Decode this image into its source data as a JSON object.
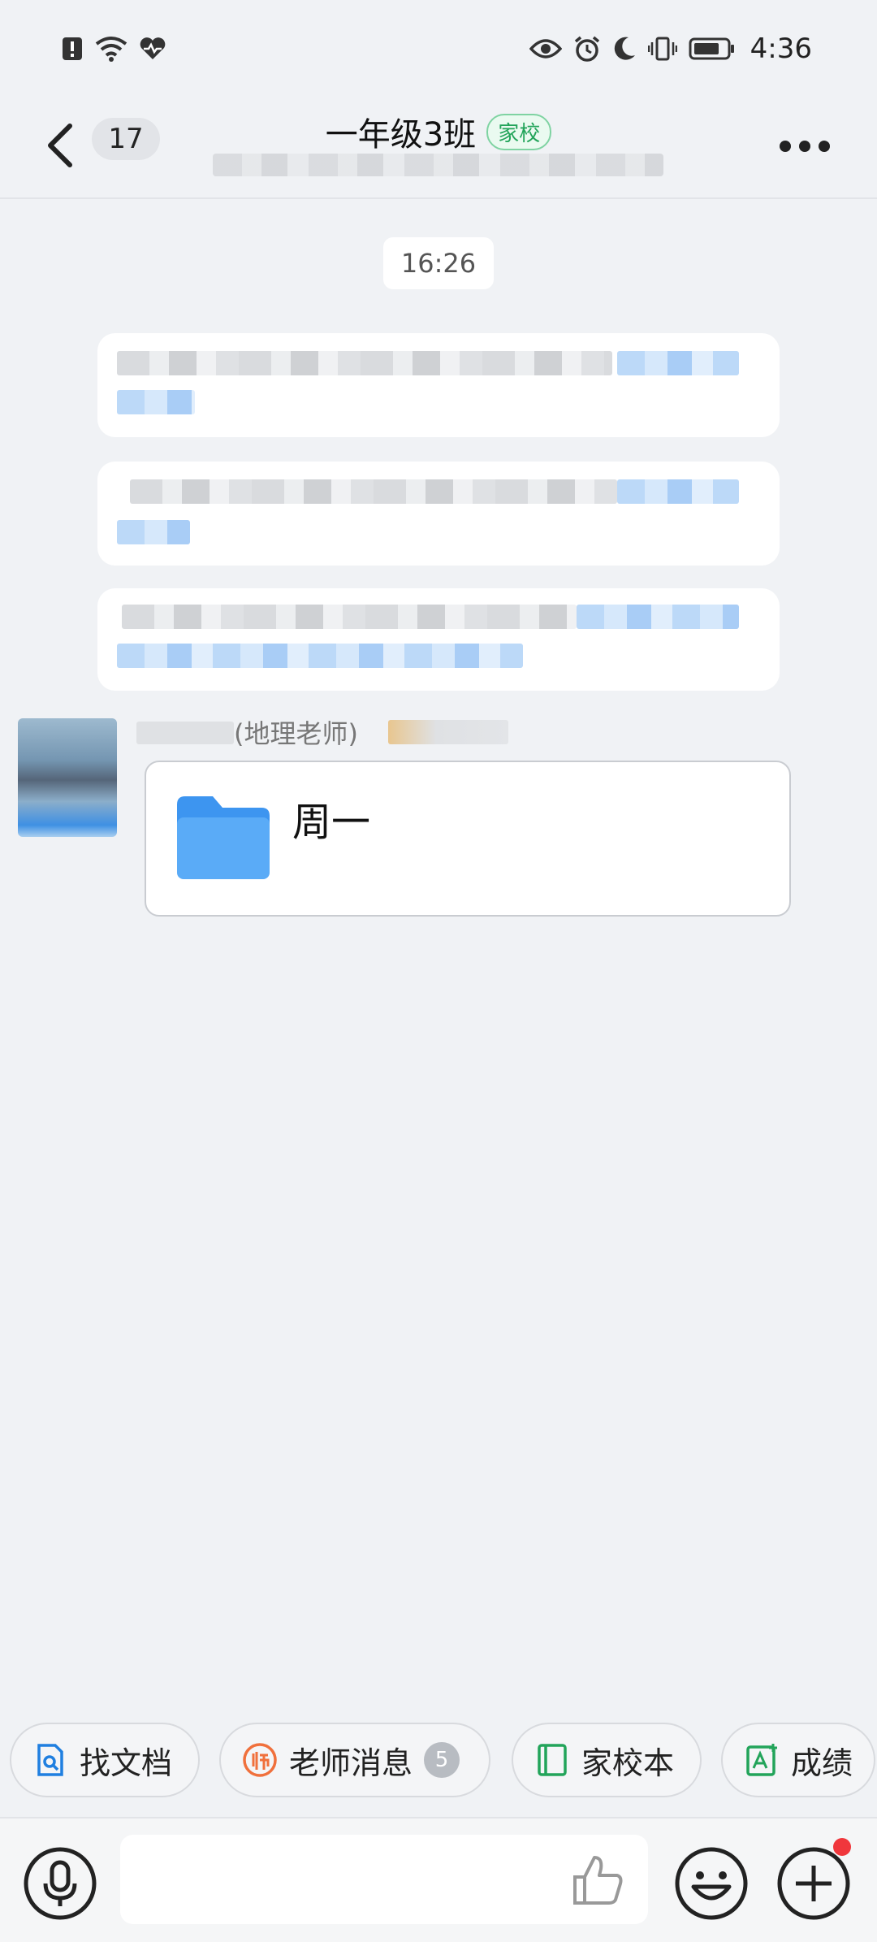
{
  "status_bar": {
    "time": "4:36"
  },
  "header": {
    "unread_count": "17",
    "title": "一年级3班",
    "tag": "家校"
  },
  "chat": {
    "time_divider": "16:26",
    "sender_name": "(地理老师)",
    "file_card": {
      "name": "周一"
    }
  },
  "quick_actions": [
    {
      "label": "找文档"
    },
    {
      "label": "老师消息",
      "badge": "5"
    },
    {
      "label": "家校本"
    },
    {
      "label": "成绩"
    }
  ],
  "input": {
    "value": "",
    "placeholder": ""
  },
  "colors": {
    "accent_green": "#22a45a",
    "link_blue": "#1f7fe0",
    "notification_red": "#f0373c"
  }
}
